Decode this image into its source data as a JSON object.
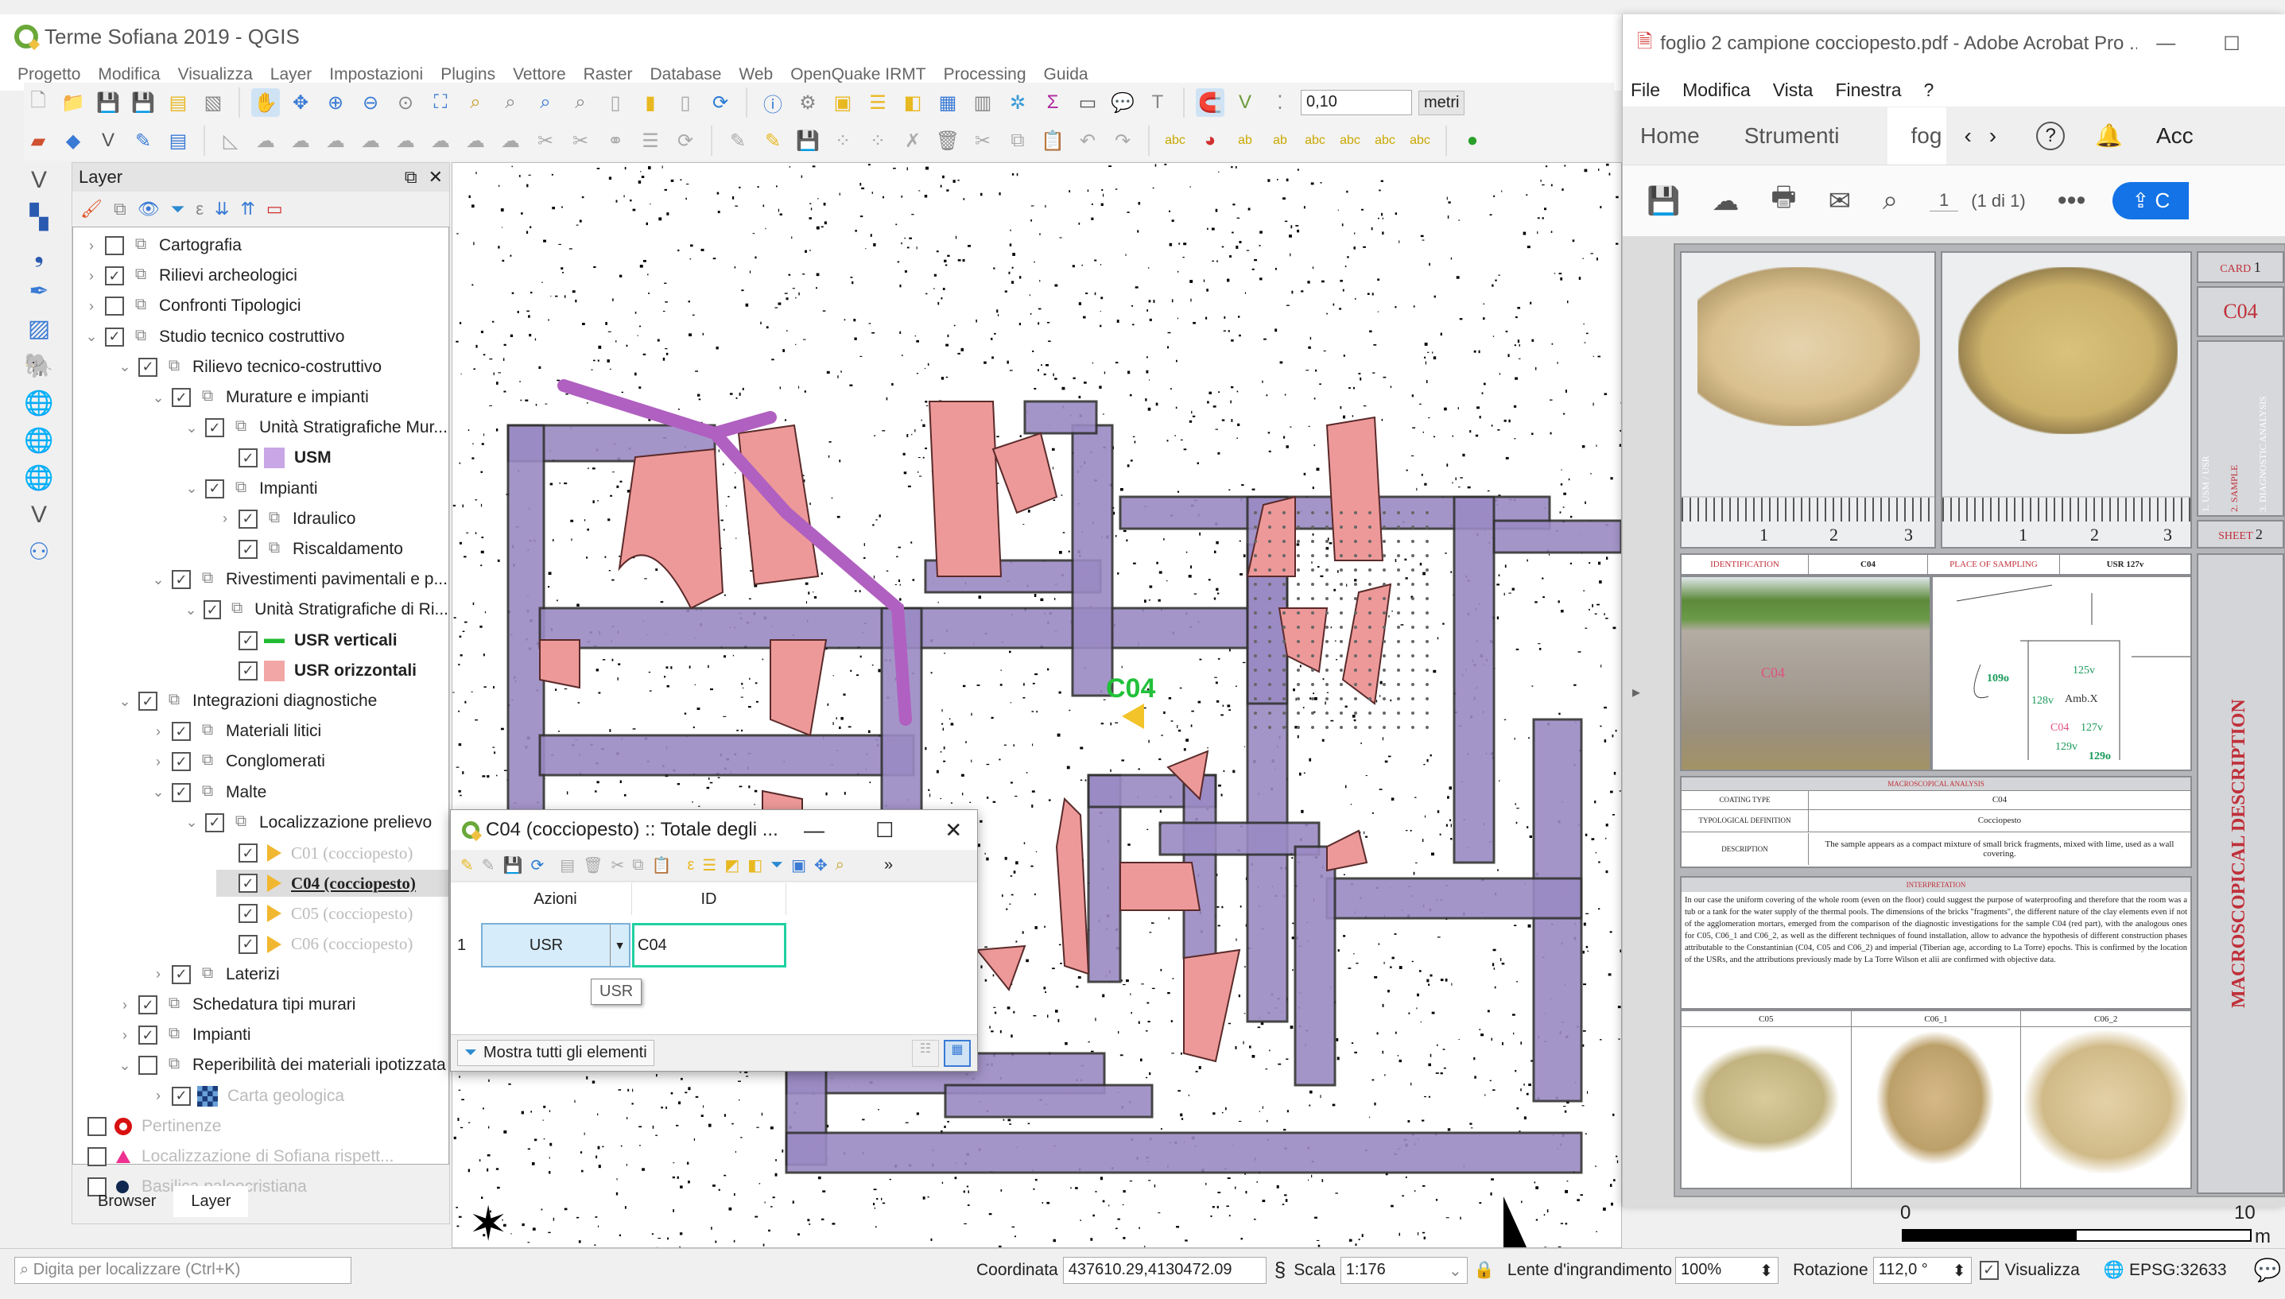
{
  "qgis": {
    "title": "Terme Sofiana 2019 - QGIS",
    "menu": [
      "Progetto",
      "Modifica",
      "Visualizza",
      "Layer",
      "Impostazioni",
      "Plugins",
      "Vettore",
      "Raster",
      "Database",
      "Web",
      "OpenQuake IRMT",
      "Processing",
      "Guida"
    ],
    "snap_tolerance": "0,10",
    "snap_unit": "metri"
  },
  "layers_panel": {
    "title": "Layer",
    "tabs": [
      "Browser",
      "Layer"
    ],
    "tree": [
      {
        "label": "Cartografia",
        "checked": false,
        "expand": ">"
      },
      {
        "label": "Rilievi archeologici",
        "checked": true,
        "expand": ">"
      },
      {
        "label": "Confronti Tipologici",
        "checked": false,
        "expand": ">"
      },
      {
        "label": "Studio tecnico costruttivo",
        "checked": true,
        "expand": "v"
      },
      {
        "label": "Rilievo tecnico-costruttivo",
        "checked": true,
        "expand": "v"
      },
      {
        "label": "Murature e impianti",
        "checked": true,
        "expand": "v"
      },
      {
        "label": "Unità Stratigrafiche Mur...",
        "checked": true,
        "expand": "v"
      },
      {
        "label": "USM",
        "checked": true,
        "swatch": "#c9a6e6"
      },
      {
        "label": "Impianti",
        "checked": true,
        "expand": "v"
      },
      {
        "label": "Idraulico",
        "checked": true,
        "expand": ">"
      },
      {
        "label": "Riscaldamento",
        "checked": true
      },
      {
        "label": "Rivestimenti pavimentali e p...",
        "checked": true,
        "expand": "v"
      },
      {
        "label": "Unità Stratigrafiche di Ri...",
        "checked": true,
        "expand": "v"
      },
      {
        "label": "USR verticali",
        "checked": true,
        "swatch": "#22bb33"
      },
      {
        "label": "USR orizzontali",
        "checked": true,
        "swatch": "#f2a6a6"
      },
      {
        "label": "Integrazioni diagnostiche",
        "checked": true,
        "expand": "v"
      },
      {
        "label": "Materiali litici",
        "checked": true,
        "expand": ">"
      },
      {
        "label": "Conglomerati",
        "checked": true,
        "expand": ">"
      },
      {
        "label": "Malte",
        "checked": true,
        "expand": "v"
      },
      {
        "label": "Localizzazione prelievo",
        "checked": true,
        "expand": "v"
      },
      {
        "label": "C01 (cocciopesto)",
        "checked": true
      },
      {
        "label": "C04 (cocciopesto)",
        "checked": true,
        "selected": true
      },
      {
        "label": "C05 (cocciopesto)",
        "checked": true
      },
      {
        "label": "C06 (cocciopesto)",
        "checked": true
      },
      {
        "label": "Laterizi",
        "checked": true,
        "expand": ">"
      },
      {
        "label": "Schedatura tipi murari",
        "checked": true,
        "expand": ">"
      },
      {
        "label": "Impianti",
        "checked": true,
        "expand": ">"
      },
      {
        "label": "Reperibilità dei materiali ipotizzata",
        "checked": false,
        "expand": "v"
      },
      {
        "label": "Carta geologica",
        "checked": true,
        "expand": ">"
      },
      {
        "label": "Pertinenze",
        "checked": false
      },
      {
        "label": "Localizzazione di Sofiana rispett...",
        "checked": false
      },
      {
        "label": "Basilica paleocristiana",
        "checked": false
      }
    ]
  },
  "map": {
    "sample_label": "C04",
    "scalebar_start": "0",
    "scalebar_end": "10",
    "scalebar_unit": "m"
  },
  "attribute_table": {
    "title": "C04 (cocciopesto) :: Totale degli ...",
    "columns": [
      "Azioni",
      "ID"
    ],
    "rows": [
      {
        "num": "1",
        "action": "USR",
        "id": "C04"
      }
    ],
    "tooltip": "USR",
    "filter_button": "Mostra tutti gli elementi"
  },
  "statusbar": {
    "search_placeholder": "Digita per localizzare (Ctrl+K)",
    "coord_label": "Coordinata",
    "coord_value": "437610.29,4130472.09",
    "scale_label": "Scala",
    "scale_value": "1:176",
    "magnifier_label": "Lente d'ingrandimento",
    "magnifier_value": "100%",
    "rotation_label": "Rotazione",
    "rotation_value": "112,0 °",
    "render_label": "Visualizza",
    "crs": "EPSG:32633"
  },
  "acrobat": {
    "title": "foglio 2 campione cocciopesto.pdf - Adobe Acrobat Pro ...",
    "menu": [
      "File",
      "Modifica",
      "Vista",
      "Finestra",
      "?"
    ],
    "tabs": [
      "Home",
      "Strumenti",
      "fog"
    ],
    "account": "Acc",
    "page_current": "1",
    "page_total": "(1 di 1)",
    "share_label": "C",
    "pdf": {
      "card_label": "CARD",
      "card_num": "1",
      "sample_code": "C04",
      "side_sections": [
        "1. USM / USR",
        "2. SAMPLE",
        "3. DIAGNOSTIC ANALYSIS"
      ],
      "sheet_label": "SHEET",
      "sheet_num": "2",
      "ruler_marks": [
        "1",
        "2",
        "3"
      ],
      "identification_label": "IDENTIFICATION",
      "identification_value": "C04",
      "place_label": "PLACE OF SAMPLING",
      "place_value": "USR 127v",
      "plan_labels": [
        "109o",
        "125v",
        "128v",
        "Amb.X",
        "C04",
        "127v",
        "129v",
        "129o"
      ],
      "photo_label": "C04",
      "macro_header": "MACROSCOPICAL ANALYSIS",
      "coating_type_label": "COATING TYPE",
      "coating_type_value": "C04",
      "typological_label": "TYPOLOGICAL DEFINITION",
      "typological_value": "Cocciopesto",
      "description_label": "DESCRIPTION",
      "description_value": "The sample appears as a compact mixture of small brick fragments, mixed with lime, used as a wall covering.",
      "interpretation_header": "INTERPRETATION",
      "interpretation_text": "In our case the uniform covering of the whole room (even on the floor) could suggest the purpose of waterproofing and therefore that the room was a tub or a tank for the water supply of the thermal pools. The dimensions of the bricks \"fragments\", the different nature of the clay elements even if not of the agglomeration mortars, emerged from the comparison of the diagnostic investigations for the sample C04 (red part), with the analogous ones for C05, C06_1 and C06_2, as well as the different techniques of found installation, allow to advance the hypothesis of different construction phases attributable to the Constantinian (C04, C05 and C06_2) and imperial (Tiberian age, according to La Torre) epochs. This is confirmed by the location of the USRs, and the attributions previously made by La Torre Wilson et alii are confirmed with objective data.",
      "comparison_samples": [
        "C05",
        "C06_1",
        "C06_2"
      ],
      "side_title": "MACROSCOPICAL DESCRIPTION"
    }
  },
  "colors": {
    "usm_purple": "#9b8ac4",
    "usr_pink": "#ee9999",
    "accent_blue": "#1473e6",
    "label_green": "#22c03a",
    "pdf_red": "#c0303a"
  }
}
